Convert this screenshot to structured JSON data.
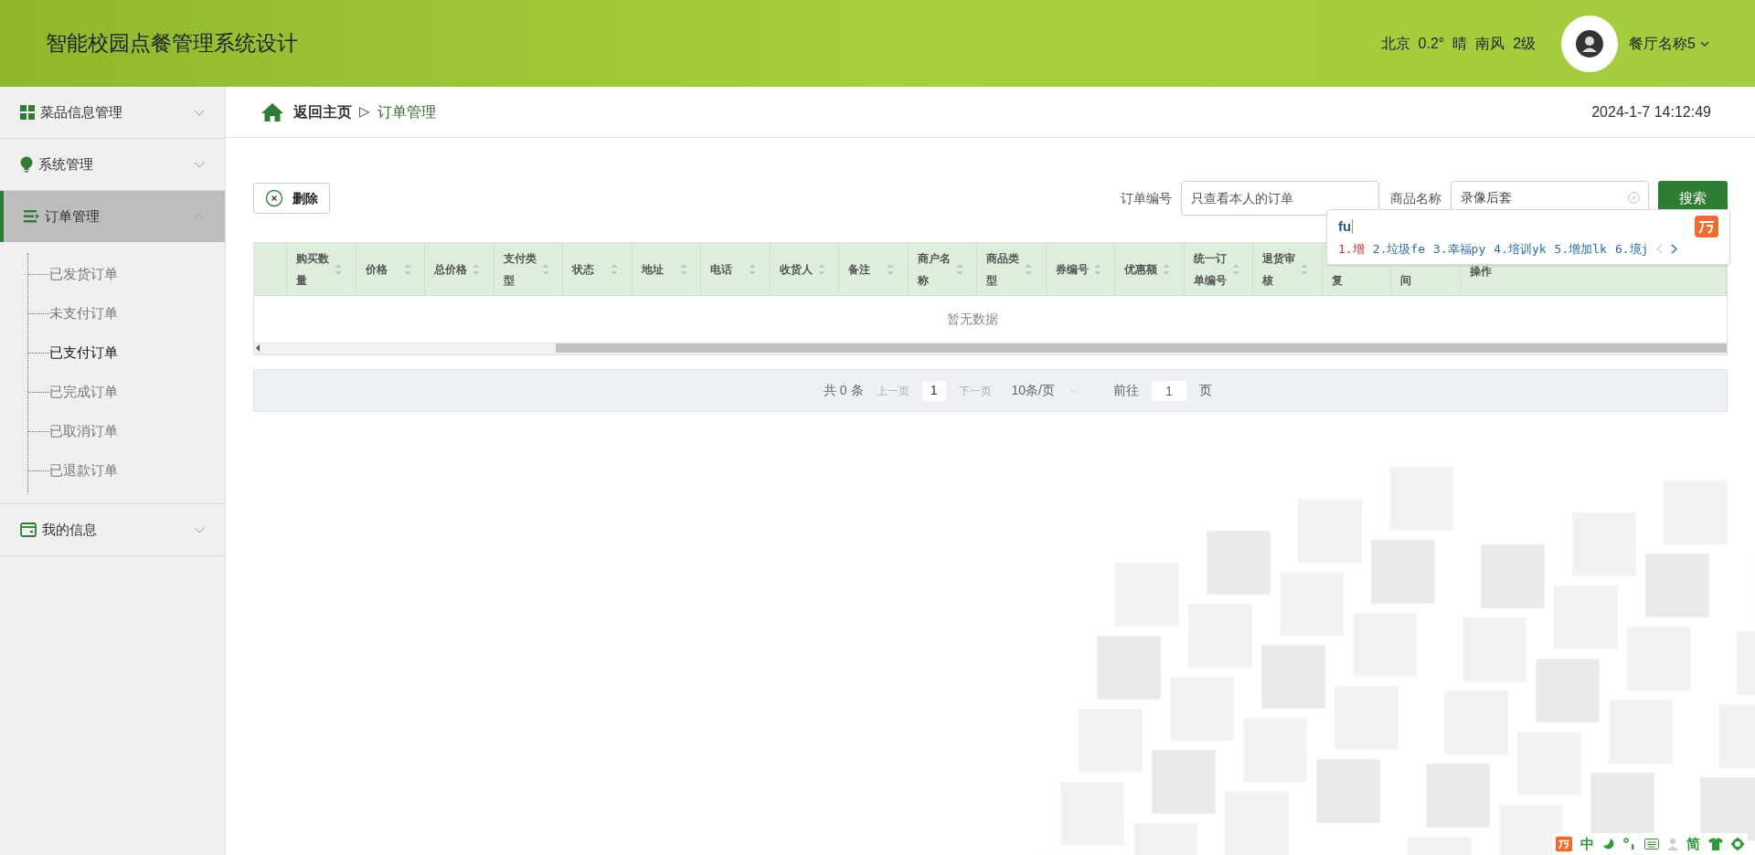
{
  "header": {
    "title": "智能校园点餐管理系统设计",
    "weather": [
      "北京",
      "0.2°",
      "晴",
      "南风",
      "2级"
    ],
    "user": "餐厅名称5"
  },
  "sidebar": {
    "groups": [
      {
        "label": "菜品信息管理",
        "kind": "grid",
        "expanded": false
      },
      {
        "label": "系统管理",
        "kind": "bulb",
        "expanded": false
      },
      {
        "label": "订单管理",
        "kind": "list",
        "expanded": true,
        "children": [
          {
            "label": "已发货订单",
            "selected": false
          },
          {
            "label": "未支付订单",
            "selected": false
          },
          {
            "label": "已支付订单",
            "selected": true
          },
          {
            "label": "已完成订单",
            "selected": false
          },
          {
            "label": "已取消订单",
            "selected": false
          },
          {
            "label": "已退款订单",
            "selected": false
          }
        ]
      },
      {
        "label": "我的信息",
        "kind": "wallet",
        "expanded": false
      }
    ]
  },
  "breadcrumb": {
    "home": "返回主页",
    "separator": "▷",
    "current": "订单管理",
    "datetime": "2024-1-7 14:12:49"
  },
  "toolbar": {
    "delete": "删除",
    "filters": [
      {
        "label": "订单编号",
        "placeholder": "只查看本人的订单"
      },
      {
        "label": "商品名称",
        "value": "录像后套"
      }
    ],
    "search": "搜索"
  },
  "ime_popup": {
    "composition": "fu",
    "candidates": [
      {
        "text": "1.增",
        "selected": true
      },
      {
        "text": "2.垃圾fe",
        "selected": false
      },
      {
        "text": "3.幸福py",
        "selected": false
      },
      {
        "text": "4.培训yk",
        "selected": false
      },
      {
        "text": "5.增加lk",
        "selected": false
      },
      {
        "text": "6.境j",
        "selected": false
      }
    ]
  },
  "table": {
    "columns": [
      {
        "label": "购买数量",
        "kind": "sortable"
      },
      {
        "label": "价格",
        "kind": "sortable"
      },
      {
        "label": "总价格",
        "kind": "sortable"
      },
      {
        "label": "支付类型",
        "kind": "sortable"
      },
      {
        "label": "状态",
        "kind": "sortable"
      },
      {
        "label": "地址",
        "kind": "sortable"
      },
      {
        "label": "电话",
        "kind": "sortable"
      },
      {
        "label": "收货人",
        "kind": "sortable"
      },
      {
        "label": "备注",
        "kind": "sortable"
      },
      {
        "label": "商户名称",
        "kind": "sortable"
      },
      {
        "label": "商品类型",
        "kind": "sortable"
      },
      {
        "label": "券编号",
        "kind": "sortable"
      },
      {
        "label": "优惠额",
        "kind": "sortable"
      },
      {
        "label": "统一订单编号",
        "kind": "sortable"
      },
      {
        "label": "退货审核",
        "kind": "sortable"
      },
      {
        "label": "复",
        "kind": "covered"
      },
      {
        "label": "间",
        "kind": "covered"
      },
      {
        "label": "操作",
        "kind": "plain"
      }
    ],
    "empty_text": "暂无数据"
  },
  "pagination": {
    "total": "共 0 条",
    "prev": "上一页",
    "page": "1",
    "next": "下一页",
    "page_size": "10条/页",
    "goto_label": "前往",
    "goto_value": "1",
    "goto_suffix": "页"
  },
  "ime_toolbar": {
    "mode": "中",
    "script": "简"
  }
}
